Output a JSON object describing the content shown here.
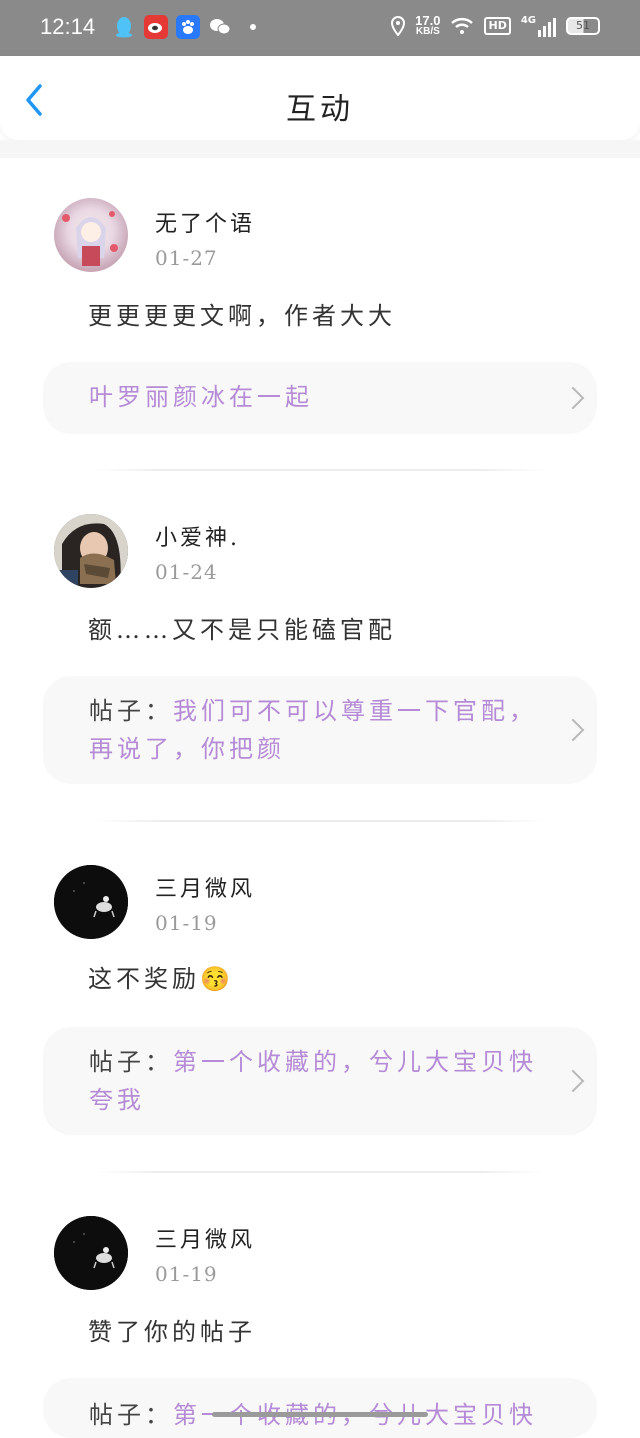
{
  "status_bar": {
    "time": "12:14",
    "net_speed": "17.0",
    "net_unit": "KB/S",
    "hd": "HD",
    "signal": "4G",
    "battery": "51",
    "icons": [
      "qq-icon",
      "weibo-icon",
      "baidu-icon",
      "wechat-icon"
    ]
  },
  "header": {
    "title": "互动"
  },
  "items": [
    {
      "name": "无了个语",
      "date": "01-27",
      "comment": "更更更更文啊，作者大大",
      "card_prefix": "",
      "card_ref": "叶罗丽颜冰在一起"
    },
    {
      "name": "小爱神.",
      "date": "01-24",
      "comment": "额……又不是只能磕官配",
      "card_prefix": "帖子：",
      "card_ref": "我们可不可以尊重一下官配，再说了，你把颜"
    },
    {
      "name": "三月微风",
      "date": "01-19",
      "comment": "这不奖励😚",
      "card_prefix": "帖子：",
      "card_ref": "第一个收藏的，兮儿大宝贝快夸我"
    },
    {
      "name": "三月微风",
      "date": "01-19",
      "comment": "赞了你的帖子",
      "card_prefix": "帖子：",
      "card_ref": "第一个收藏的，兮儿大宝贝快"
    }
  ],
  "colors": {
    "accent": "#2196f3",
    "link": "#b58ad6",
    "status_bar_bg": "#8a8a8a",
    "card_bg": "#f8f8f8"
  }
}
